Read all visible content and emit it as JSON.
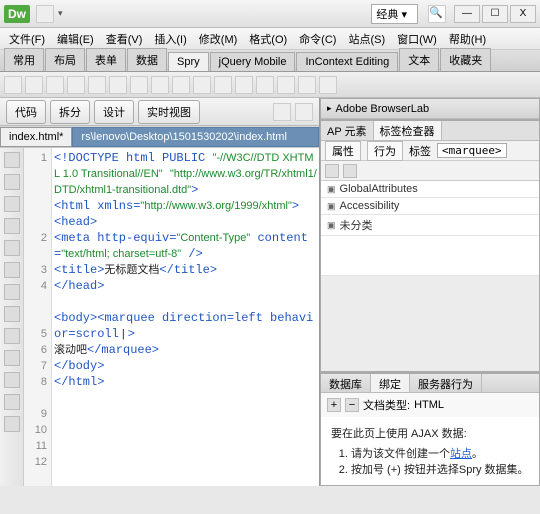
{
  "title": {
    "logo": "Dw",
    "layout": "经典"
  },
  "winbtns": {
    "min": "—",
    "max": "☐",
    "close": "X"
  },
  "menubar": [
    "文件(F)",
    "编辑(E)",
    "查看(V)",
    "插入(I)",
    "修改(M)",
    "格式(O)",
    "命令(C)",
    "站点(S)",
    "窗口(W)",
    "帮助(H)"
  ],
  "insert_tabs": [
    "常用",
    "布局",
    "表单",
    "数据",
    "Spry",
    "jQuery Mobile",
    "InContext Editing",
    "文本",
    "收藏夹"
  ],
  "insert_active": 4,
  "view_buttons": [
    "代码",
    "拆分",
    "设计",
    "实时视图"
  ],
  "doc_tabs": {
    "active": "index.html*",
    "path": "rs\\lenovo\\Desktop\\1501530202\\index.html"
  },
  "line_numbers": [
    1,
    2,
    3,
    4,
    5,
    6,
    7,
    8,
    9,
    10,
    11,
    12
  ],
  "code": {
    "l1a": "<!DOCTYPE html PUBLIC ",
    "l1b": "\"-//W3C//DTD XHTML 1.0 Transitional//EN\"",
    "l1c": " ",
    "l1d": "\"http://www.w3.org/TR/xhtml1/DTD/xhtml1-transitional.dtd\"",
    "l1e": ">",
    "l2a": "<html xmlns=",
    "l2b": "\"http://www.w3.org/1999/xhtml\"",
    "l2c": ">",
    "l3": "<head>",
    "l4a": "<meta http-equiv=",
    "l4b": "\"Content-Type\"",
    "l4c": " content=",
    "l4d": "\"text/html; charset=utf-8\"",
    "l4e": " />",
    "l5a": "<title>",
    "l5b": "无标题文档",
    "l5c": "</title>",
    "l6": "</head>",
    "l7": "",
    "l8a": "<body><marquee direction=left behavior=scroll",
    "l8cur": " | ",
    "l8b": ">",
    "l9a": "滚动吧",
    "l9b": "</marquee>",
    "l10": "</body>",
    "l11": "</html>"
  },
  "panels": {
    "browserlab": "Adobe BrowserLab",
    "prop_tabs": [
      "AP 元素",
      "标签检查器"
    ],
    "prop_tabs_active": 1,
    "sub_tabs": [
      "属性",
      "行为"
    ],
    "sub_label": "标签",
    "tag_value": "<marquee>",
    "rows": [
      "GlobalAttributes",
      "Accessibility",
      "未分类"
    ],
    "bind_tabs": [
      "数据库",
      "绑定",
      "服务器行为"
    ],
    "bind_active": 1,
    "doc_type_label": "文档类型:",
    "doc_type_value": "HTML",
    "ajax_title": "要在此页上使用 AJAX 数据:",
    "ajax_step1a": "请为该文件创建一个",
    "ajax_step1b": "站点",
    "ajax_step1c": "。",
    "ajax_step2": "按加号 (+) 按钮并选择Spry 数据集。"
  }
}
